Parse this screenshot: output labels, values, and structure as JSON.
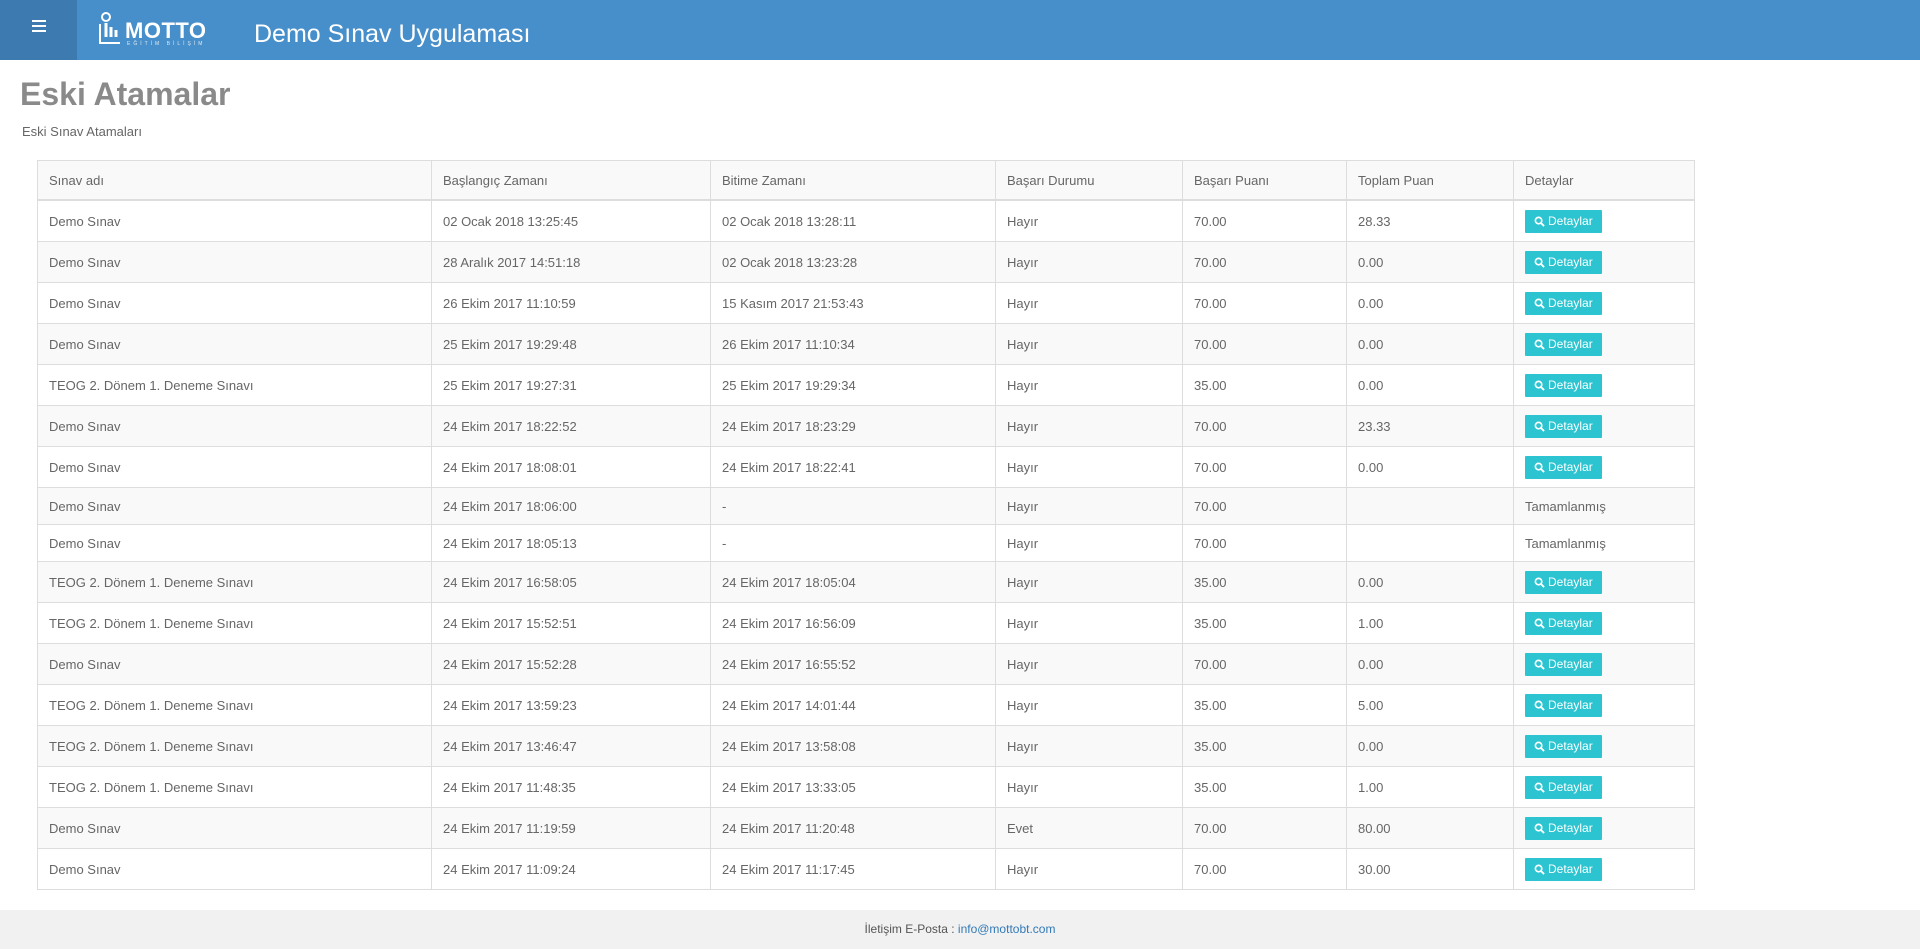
{
  "header": {
    "logo_text": "MOTTO",
    "logo_subtext": "EĞİTİM BİLİŞİM",
    "app_title": "Demo Sınav Uygulaması"
  },
  "page": {
    "title": "Eski Atamalar",
    "subtitle": "Eski Sınav Atamaları"
  },
  "table": {
    "columns": [
      "Sınav adı",
      "Başlangıç Zamanı",
      "Bitime Zamanı",
      "Başarı Durumu",
      "Başarı Puanı",
      "Toplam Puan",
      "Detaylar"
    ],
    "detail_button_label": "Detaylar",
    "rows": [
      {
        "name": "Demo Sınav",
        "start": "02 Ocak 2018 13:25:45",
        "end": "02 Ocak 2018 13:28:11",
        "status": "Hayır",
        "pass_score": "70.00",
        "total": "28.33",
        "detail": "button"
      },
      {
        "name": "Demo Sınav",
        "start": "28 Aralık 2017 14:51:18",
        "end": "02 Ocak 2018 13:23:28",
        "status": "Hayır",
        "pass_score": "70.00",
        "total": "0.00",
        "detail": "button"
      },
      {
        "name": "Demo Sınav",
        "start": "26 Ekim 2017 11:10:59",
        "end": "15 Kasım 2017 21:53:43",
        "status": "Hayır",
        "pass_score": "70.00",
        "total": "0.00",
        "detail": "button"
      },
      {
        "name": "Demo Sınav",
        "start": "25 Ekim 2017 19:29:48",
        "end": "26 Ekim 2017 11:10:34",
        "status": "Hayır",
        "pass_score": "70.00",
        "total": "0.00",
        "detail": "button"
      },
      {
        "name": "TEOG 2. Dönem 1. Deneme Sınavı",
        "start": "25 Ekim 2017 19:27:31",
        "end": "25 Ekim 2017 19:29:34",
        "status": "Hayır",
        "pass_score": "35.00",
        "total": "0.00",
        "detail": "button"
      },
      {
        "name": "Demo Sınav",
        "start": "24 Ekim 2017 18:22:52",
        "end": "24 Ekim 2017 18:23:29",
        "status": "Hayır",
        "pass_score": "70.00",
        "total": "23.33",
        "detail": "button"
      },
      {
        "name": "Demo Sınav",
        "start": "24 Ekim 2017 18:08:01",
        "end": "24 Ekim 2017 18:22:41",
        "status": "Hayır",
        "pass_score": "70.00",
        "total": "0.00",
        "detail": "button"
      },
      {
        "name": "Demo Sınav",
        "start": "24 Ekim 2017 18:06:00",
        "end": "-",
        "status": "Hayır",
        "pass_score": "70.00",
        "total": "",
        "detail": "Tamamlanmış"
      },
      {
        "name": "Demo Sınav",
        "start": "24 Ekim 2017 18:05:13",
        "end": "-",
        "status": "Hayır",
        "pass_score": "70.00",
        "total": "",
        "detail": "Tamamlanmış"
      },
      {
        "name": "TEOG 2. Dönem 1. Deneme Sınavı",
        "start": "24 Ekim 2017 16:58:05",
        "end": "24 Ekim 2017 18:05:04",
        "status": "Hayır",
        "pass_score": "35.00",
        "total": "0.00",
        "detail": "button"
      },
      {
        "name": "TEOG 2. Dönem 1. Deneme Sınavı",
        "start": "24 Ekim 2017 15:52:51",
        "end": "24 Ekim 2017 16:56:09",
        "status": "Hayır",
        "pass_score": "35.00",
        "total": "1.00",
        "detail": "button"
      },
      {
        "name": "Demo Sınav",
        "start": "24 Ekim 2017 15:52:28",
        "end": "24 Ekim 2017 16:55:52",
        "status": "Hayır",
        "pass_score": "70.00",
        "total": "0.00",
        "detail": "button"
      },
      {
        "name": "TEOG 2. Dönem 1. Deneme Sınavı",
        "start": "24 Ekim 2017 13:59:23",
        "end": "24 Ekim 2017 14:01:44",
        "status": "Hayır",
        "pass_score": "35.00",
        "total": "5.00",
        "detail": "button"
      },
      {
        "name": "TEOG 2. Dönem 1. Deneme Sınavı",
        "start": "24 Ekim 2017 13:46:47",
        "end": "24 Ekim 2017 13:58:08",
        "status": "Hayır",
        "pass_score": "35.00",
        "total": "0.00",
        "detail": "button"
      },
      {
        "name": "TEOG 2. Dönem 1. Deneme Sınavı",
        "start": "24 Ekim 2017 11:48:35",
        "end": "24 Ekim 2017 13:33:05",
        "status": "Hayır",
        "pass_score": "35.00",
        "total": "1.00",
        "detail": "button"
      },
      {
        "name": "Demo Sınav",
        "start": "24 Ekim 2017 11:19:59",
        "end": "24 Ekim 2017 11:20:48",
        "status": "Evet",
        "pass_score": "70.00",
        "total": "80.00",
        "detail": "button"
      },
      {
        "name": "Demo Sınav",
        "start": "24 Ekim 2017 11:09:24",
        "end": "24 Ekim 2017 11:17:45",
        "status": "Hayır",
        "pass_score": "70.00",
        "total": "30.00",
        "detail": "button"
      }
    ]
  },
  "footer": {
    "label": "İletişim E-Posta :",
    "email": "info@mottobt.com"
  },
  "colors": {
    "header": "#478fca",
    "menu_toggle": "#3c7ab0",
    "detail_button": "#2bc4d0"
  },
  "icons": {
    "menu": "hamburger-icon",
    "detail": "search-icon",
    "logo": "motto-logo-icon"
  }
}
